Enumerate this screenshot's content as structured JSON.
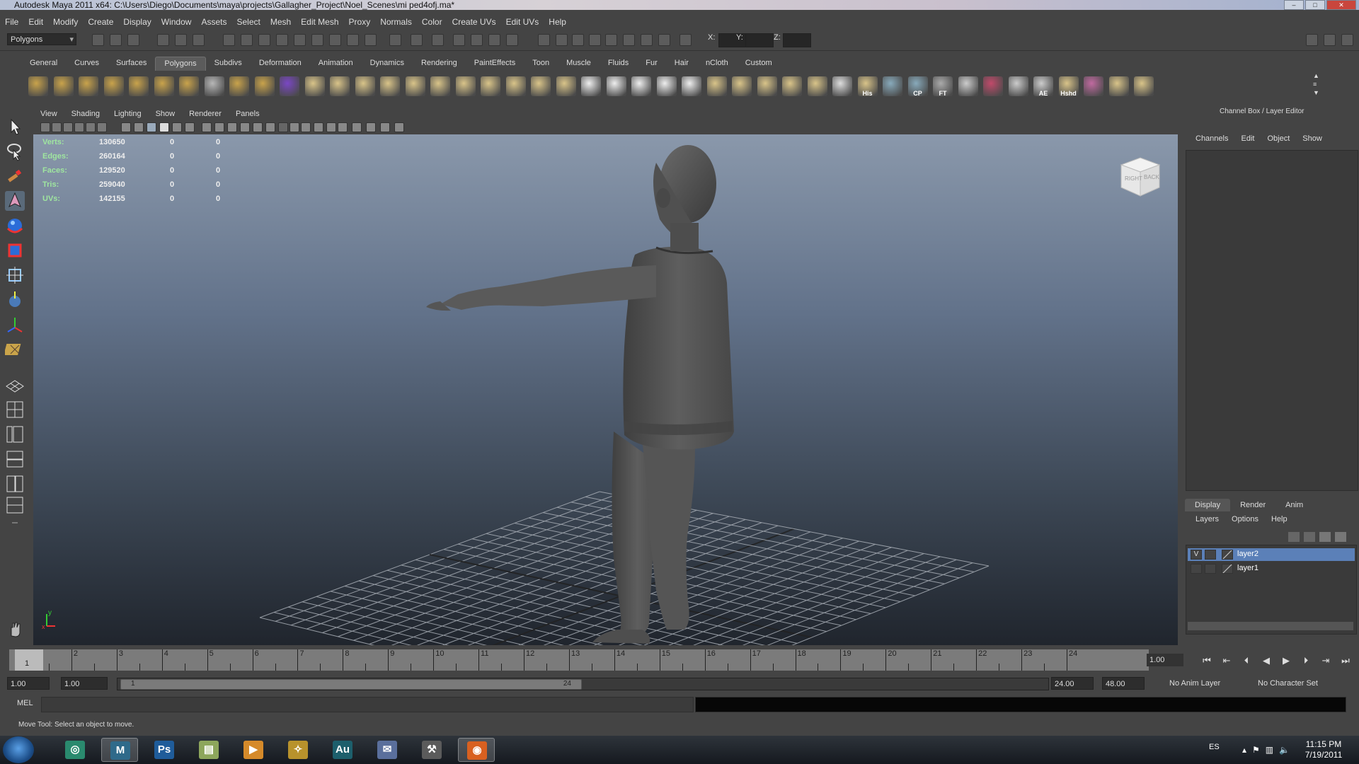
{
  "window": {
    "title": "Autodesk Maya 2011 x64: C:\\Users\\Diego\\Documents\\maya\\projects\\Gallagher_Project\\Noel_Scenes\\mi ped4ofj.ma*"
  },
  "menubar": [
    "File",
    "Edit",
    "Modify",
    "Create",
    "Display",
    "Window",
    "Assets",
    "Select",
    "Mesh",
    "Edit Mesh",
    "Proxy",
    "Normals",
    "Color",
    "Create UVs",
    "Edit UVs",
    "Help"
  ],
  "statusline": {
    "mode": "Polygons",
    "x_label": "X:",
    "y_label": "Y:",
    "z_label": "Z:"
  },
  "shelf_tabs": [
    "General",
    "Curves",
    "Surfaces",
    "Polygons",
    "Subdivs",
    "Deformation",
    "Animation",
    "Dynamics",
    "Rendering",
    "PaintEffects",
    "Toon",
    "Muscle",
    "Fluids",
    "Fur",
    "Hair",
    "nCloth",
    "Custom"
  ],
  "shelf_active": "Polygons",
  "shelf_icon_labels": {
    "his": "His",
    "cp": "CP",
    "ft": "FT",
    "ae": "AE",
    "hshd": "Hshd"
  },
  "viewport_menu": [
    "View",
    "Shading",
    "Lighting",
    "Show",
    "Renderer",
    "Panels"
  ],
  "hud": [
    {
      "label": "Verts:",
      "v1": "130650",
      "v2": "0",
      "v3": "0"
    },
    {
      "label": "Edges:",
      "v1": "260164",
      "v2": "0",
      "v3": "0"
    },
    {
      "label": "Faces:",
      "v1": "129520",
      "v2": "0",
      "v3": "0"
    },
    {
      "label": "Tris:",
      "v1": "259040",
      "v2": "0",
      "v3": "0"
    },
    {
      "label": "UVs:",
      "v1": "142155",
      "v2": "0",
      "v3": "0"
    }
  ],
  "viewcube": {
    "right": "RIGHT",
    "back": "BACK"
  },
  "axis": {
    "y": "y",
    "x": "x"
  },
  "channel_box": {
    "title": "Channel Box / Layer Editor",
    "menu": [
      "Channels",
      "Edit",
      "Object",
      "Show"
    ]
  },
  "layer_editor": {
    "tabs": [
      "Display",
      "Render",
      "Anim"
    ],
    "active_tab": "Display",
    "menu": [
      "Layers",
      "Options",
      "Help"
    ],
    "layers": [
      {
        "visible": "V",
        "name": "layer2",
        "selected": true
      },
      {
        "visible": "",
        "name": "layer1",
        "selected": false
      }
    ]
  },
  "timeline": {
    "ticks": [
      "1",
      "2",
      "3",
      "4",
      "5",
      "6",
      "7",
      "8",
      "9",
      "10",
      "11",
      "12",
      "13",
      "14",
      "15",
      "16",
      "17",
      "18",
      "19",
      "20",
      "21",
      "22",
      "23",
      "24"
    ],
    "current_frame": "1.00",
    "current_marker": "1"
  },
  "range": {
    "start": "1.00",
    "start2": "1.00",
    "slider_start": "1",
    "slider_end": "24",
    "end": "24.00",
    "end2": "48.00",
    "anim_layer": "No Anim Layer",
    "character_set": "No Character Set"
  },
  "command_line": {
    "label": "MEL"
  },
  "help_line": "Move Tool: Select an object to move.",
  "taskbar": {
    "lang": "ES",
    "time": "11:15 PM",
    "date": "7/19/2011",
    "apps": [
      {
        "name": "chrome",
        "glyph": "◎",
        "color": "#2a8a6e"
      },
      {
        "name": "maya",
        "glyph": "M",
        "color": "#2f6a8a"
      },
      {
        "name": "photoshop",
        "glyph": "Ps",
        "color": "#1f5c9a"
      },
      {
        "name": "notes",
        "glyph": "▤",
        "color": "#8da65c"
      },
      {
        "name": "media-player",
        "glyph": "▶",
        "color": "#d58a2a"
      },
      {
        "name": "explorer",
        "glyph": "✧",
        "color": "#b8922c"
      },
      {
        "name": "audition",
        "glyph": "Au",
        "color": "#1d5f6c"
      },
      {
        "name": "mail",
        "glyph": "✉",
        "color": "#5a6f9c"
      },
      {
        "name": "tool",
        "glyph": "⚒",
        "color": "#5b5b5b"
      },
      {
        "name": "firefox",
        "glyph": "◉",
        "color": "#d86020"
      }
    ]
  }
}
